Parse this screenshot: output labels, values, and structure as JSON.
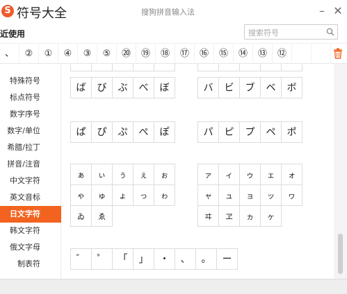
{
  "window": {
    "app_title": "符号大全",
    "sub_title": "搜狗拼音输入法",
    "logo": "S"
  },
  "recent": {
    "label": "最近使用",
    "items": [
      "、",
      "②",
      "①",
      "④",
      "③",
      "⑤",
      "⑳",
      "⑲",
      "⑱",
      "⑰",
      "⑯",
      "⑮",
      "⑭",
      "⑬",
      "⑫"
    ]
  },
  "search": {
    "placeholder": "搜索符号",
    "value": ""
  },
  "sidebar": {
    "items": [
      "特殊符号",
      "标点符号",
      "数字序号",
      "数字/单位",
      "希腊/拉丁",
      "拼音/注音",
      "中文字符",
      "英文音标",
      "日文字符",
      "韩文字符",
      "俄文字母",
      "制表符"
    ],
    "active": "日文字符"
  },
  "groups": {
    "hiragana_b": [
      "ば",
      "び",
      "ぶ",
      "べ",
      "ぼ"
    ],
    "katakana_b": [
      "バ",
      "ビ",
      "ブ",
      "ベ",
      "ボ"
    ],
    "hiragana_p": [
      "ぱ",
      "ぴ",
      "ぷ",
      "ぺ",
      "ぽ"
    ],
    "katakana_p": [
      "パ",
      "ピ",
      "プ",
      "ペ",
      "ポ"
    ],
    "hiragana_small": [
      "ぁ",
      "ぃ",
      "ぅ",
      "ぇ",
      "ぉ",
      "ゃ",
      "ゅ",
      "ょ",
      "っ",
      "ゎ",
      "ゐ",
      "ゑ"
    ],
    "katakana_small": [
      "ァ",
      "ィ",
      "ゥ",
      "ェ",
      "ォ",
      "ャ",
      "ュ",
      "ョ",
      "ッ",
      "ヮ",
      "ヰ",
      "ヱ",
      "ヵ",
      "ヶ"
    ],
    "marks": [
      "゛",
      "゜",
      "「",
      "」",
      "・",
      "、",
      "。",
      "ー"
    ]
  },
  "colors": {
    "accent": "#f2631f"
  }
}
